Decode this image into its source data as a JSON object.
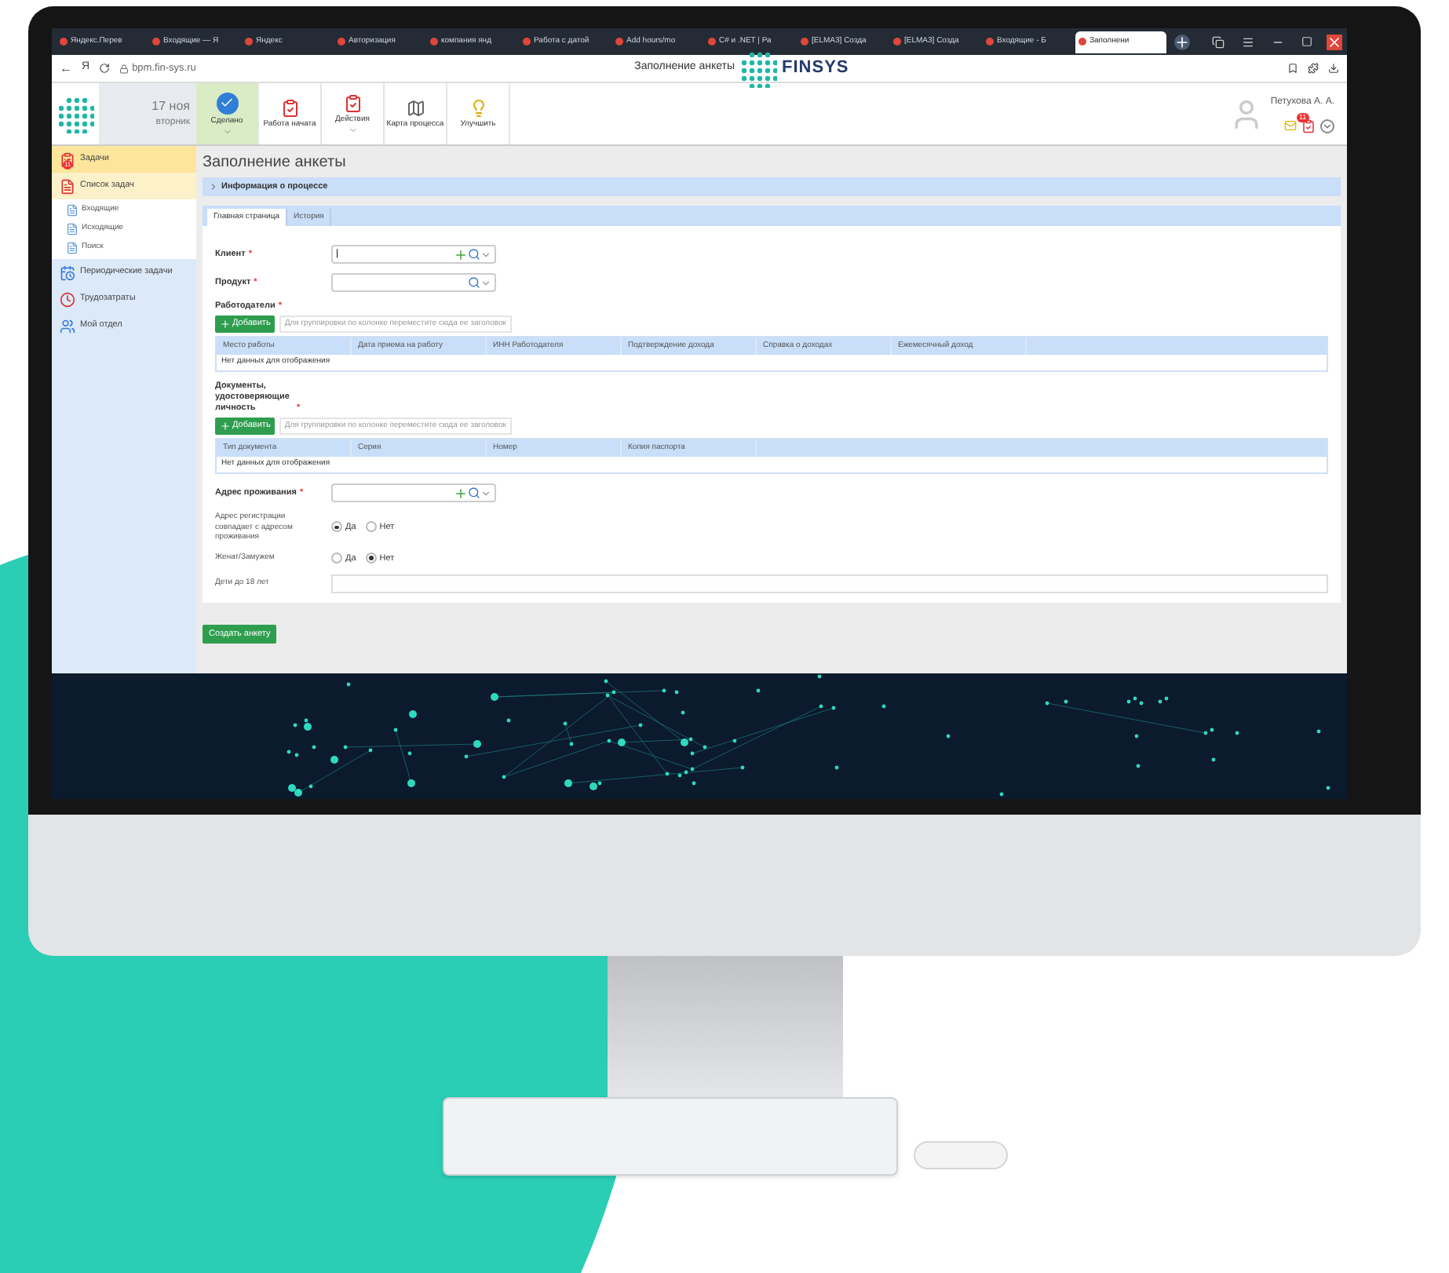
{
  "browser": {
    "tabs": [
      {
        "label": "Яндекс.Перев",
        "selected": false
      },
      {
        "label": "Входящие — Я",
        "selected": false
      },
      {
        "label": "Яндекс",
        "selected": false
      },
      {
        "label": "Авторизация",
        "selected": false
      },
      {
        "label": "компания янд",
        "selected": false
      },
      {
        "label": "Работа с датой",
        "selected": false
      },
      {
        "label": "Add hours/mo",
        "selected": false
      },
      {
        "label": "C# и .NET | Ра",
        "selected": false
      },
      {
        "label": "[ELMA3] Созда",
        "selected": false
      },
      {
        "label": "[ELMA3] Созда",
        "selected": false
      },
      {
        "label": "Входящие - Б",
        "selected": false
      },
      {
        "label": "Заполнени",
        "selected": true
      }
    ],
    "back": "←",
    "yandex": "Я",
    "address": "bpm.fin-sys.ru",
    "page_title": "Заполнение анкеты",
    "logo": "FINSYS"
  },
  "toolbar": {
    "date": "17 ноя",
    "weekday": "вторник",
    "buttons": [
      {
        "label": "Сделано",
        "kind": "done",
        "dropdown": true,
        "selected": true
      },
      {
        "label": "Работа начата",
        "kind": "start",
        "dropdown": false,
        "selected": false
      },
      {
        "label": "Действия",
        "kind": "actions",
        "dropdown": true,
        "selected": false
      },
      {
        "label": "Карта процесса",
        "kind": "map",
        "dropdown": false,
        "selected": false
      },
      {
        "label": "Улучшить",
        "kind": "improve",
        "dropdown": false,
        "selected": false
      }
    ],
    "user": "Петухова А. А.",
    "badge": "11"
  },
  "sidebar": {
    "items": [
      {
        "label": "Задачи",
        "kind": "tasks",
        "selected": true,
        "badge": "11"
      },
      {
        "label": "Список задач",
        "kind": "list",
        "selected": false,
        "expanded": true,
        "children": [
          {
            "label": "Входящие",
            "kind": "sub"
          },
          {
            "label": "Исходящие",
            "kind": "sub"
          },
          {
            "label": "Поиск",
            "kind": "sub"
          }
        ]
      },
      {
        "label": "Периодические задачи",
        "kind": "periodic",
        "selected": false
      },
      {
        "label": "Трудозатраты",
        "kind": "time",
        "selected": false
      },
      {
        "label": "Мой отдел",
        "kind": "dept",
        "selected": false
      }
    ]
  },
  "main": {
    "title": "Заполнение анкеты",
    "info_panel": {
      "label": "Информация о процессе",
      "expanded": false
    },
    "tabs": [
      {
        "label": "Главная страница",
        "selected": true
      },
      {
        "label": "История",
        "selected": false
      }
    ],
    "form": [
      {
        "kind": "lookup",
        "label": "Клиент",
        "required_mark": "*",
        "add": true,
        "value": "|"
      },
      {
        "kind": "lookup",
        "label": "Продукт",
        "required_mark": "*",
        "add": false
      },
      {
        "kind": "grid",
        "label": "Работодатели",
        "required_mark": "*",
        "add_button": "Добавить",
        "group_hint": "Для группировки по колонке переместите сюда ее заголовок",
        "columns": [
          "Место работы",
          "Дата приема на работу",
          "ИНН Работодателя",
          "Подтверждение дохода",
          "Справка о доходах",
          "Ежемесячный доход"
        ],
        "empty": "Нет данных для отображения"
      },
      {
        "kind": "grid",
        "label": "Документы, удостоверяющие личность",
        "required_mark": "*",
        "add_button": "Добавить",
        "group_hint": "Для группировки по колонке переместите сюда ее заголовок",
        "columns": [
          "Тип документа",
          "Серия",
          "Номер",
          "Копия паспорта"
        ],
        "empty": "Нет данных для отображения"
      },
      {
        "kind": "lookup",
        "label": "Адрес проживания",
        "required_mark": "*",
        "add": true
      },
      {
        "kind": "radio",
        "label": "Адрес регистрации совпадает с адресом проживания",
        "options": [
          {
            "label": "Да",
            "selected": true
          },
          {
            "label": "Нет",
            "selected": false
          }
        ]
      },
      {
        "kind": "radio",
        "label": "Женат/Замужем",
        "options": [
          {
            "label": "Да",
            "selected": false
          },
          {
            "label": "Нет",
            "selected": true
          }
        ]
      },
      {
        "kind": "text",
        "label": "Дети до 18 лет"
      }
    ],
    "submit": "Создать анкету"
  }
}
